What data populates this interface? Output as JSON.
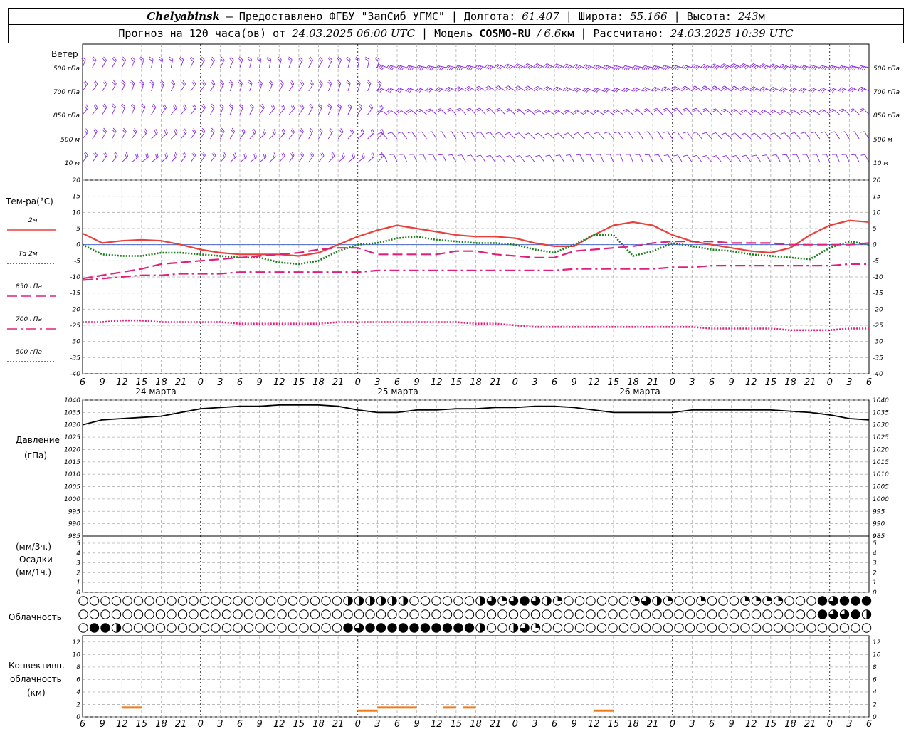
{
  "header": {
    "city": "Chelyabinsk",
    "dash": "—",
    "provider": "Предоставлено ФГБУ \"ЗапСиб УГМС\"",
    "lon_label": "Долгота:",
    "lon_value": "61.407",
    "lat_label": "Широта:",
    "lat_value": "55.166",
    "alt_label": "Высота:",
    "alt_value": "243",
    "alt_unit": "м",
    "forecast_prefix": "Прогноз на 120 часа(ов) от",
    "forecast_time": "24.03.2025 06:00 UTC",
    "model_label": "Модель",
    "model_name": "COSMO-RU",
    "model_res": "/ 6.6",
    "model_res_unit": "км",
    "calc_label": "Рассчитано:",
    "calc_time": "24.03.2025 10:39 UTC"
  },
  "wind_panel": {
    "title": "Ветер",
    "levels": [
      "500 гПа",
      "700 гПа",
      "850 гПа",
      "500 м",
      "10 м"
    ],
    "color": "#8a2be2"
  },
  "temp_panel": {
    "title": "Тем-ра(°C)",
    "yticks": [
      "20",
      "15",
      "10",
      "5",
      "0",
      "-5",
      "-10",
      "-15",
      "-20",
      "-25",
      "-30",
      "-35",
      "-40"
    ],
    "legend": [
      {
        "label": "2м",
        "color": "#e8413c",
        "style": "solid"
      },
      {
        "label": "Td 2м",
        "color": "#1a7f1a",
        "style": "dotted"
      },
      {
        "label": "850 гПа",
        "color": "#e0207e",
        "style": "dashed"
      },
      {
        "label": "700 гПа",
        "color": "#e0207e",
        "style": "dashdot"
      },
      {
        "label": "500 гПа",
        "color": "#e0207e",
        "style": "dotted"
      }
    ]
  },
  "pressure_panel": {
    "title": "Давление",
    "unit": "(гПа)",
    "yticks": [
      "1040",
      "1035",
      "1030",
      "1025",
      "1020",
      "1015",
      "1010",
      "1005",
      "1000",
      "995",
      "990",
      "985"
    ]
  },
  "precip_panel": {
    "unit3": "(мм/3ч.)",
    "title": "Осадки",
    "unit1": "(мм/1ч.)",
    "yticks": [
      "5",
      "4",
      "3",
      "2",
      "1",
      "0"
    ]
  },
  "cloud_panel": {
    "title": "Облачность"
  },
  "conv_panel": {
    "title1": "Конвективн.",
    "title2": "облачность",
    "unit": "(км)",
    "yticks": [
      "12",
      "10",
      "8",
      "6",
      "4",
      "2",
      "0"
    ],
    "color": "#f07c1a"
  },
  "x_axis": {
    "hour_labels": [
      "6",
      "9",
      "12",
      "15",
      "18",
      "21",
      "0",
      "3",
      "6",
      "9",
      "12",
      "15",
      "18",
      "21",
      "0",
      "3",
      "6",
      "9",
      "12",
      "15",
      "18",
      "21",
      "0",
      "3",
      "6",
      "9",
      "12"
    ],
    "day_labels": [
      "24 марта",
      "25 марта",
      "26 марта"
    ]
  },
  "chart_data": [
    {
      "type": "line",
      "title": "Тем-ра(°C)",
      "x_hours_from_start": [
        0,
        3,
        6,
        9,
        12,
        15,
        18,
        21,
        24,
        27,
        30,
        33,
        36,
        39,
        42,
        45,
        48,
        51,
        54,
        57,
        60,
        63,
        66,
        69,
        72,
        75,
        78,
        81,
        84,
        87,
        90,
        93,
        96,
        99,
        102,
        105,
        108,
        111,
        114,
        117,
        120
      ],
      "series": [
        {
          "name": "2м",
          "values": [
            3.5,
            0.5,
            1.2,
            1.5,
            1.2,
            0,
            -1.5,
            -2.5,
            -3,
            -3,
            -3,
            -3.5,
            -2.5,
            0,
            2.5,
            4.5,
            6,
            5,
            4,
            3,
            2.5,
            2.5,
            2,
            0.5,
            -0.5,
            -0.5,
            3,
            6,
            7,
            6,
            3,
            1,
            0,
            -1,
            -2,
            -2.5,
            -1,
            3,
            6,
            7.5,
            7
          ]
        },
        {
          "name": "Td 2м",
          "values": [
            0,
            -3,
            -3.5,
            -3.5,
            -2.5,
            -2.5,
            -3,
            -3.5,
            -4,
            -4,
            -5.5,
            -6,
            -5,
            -2,
            0,
            0.5,
            2,
            2.5,
            1.5,
            1,
            0.5,
            0.5,
            0,
            -1.5,
            -2.5,
            0,
            3,
            3,
            -3.5,
            -2,
            0.5,
            -0.5,
            -1.5,
            -2,
            -3,
            -3.5,
            -4,
            -4.5,
            -1,
            1,
            0
          ]
        },
        {
          "name": "850 гПа",
          "values": [
            -10.5,
            -9.5,
            -8.5,
            -7.5,
            -6,
            -5.5,
            -5,
            -4.5,
            -4,
            -3.5,
            -3,
            -2.5,
            -1.5,
            -1,
            -1,
            -3,
            -3,
            -3,
            -3,
            -2,
            -2,
            -3,
            -3.5,
            -4,
            -4,
            -2,
            -1.5,
            -1,
            -0.5,
            0.5,
            1,
            1,
            1,
            0.5,
            0.5,
            0.5,
            0,
            0,
            0,
            0,
            0.5
          ]
        },
        {
          "name": "700 гПа",
          "values": [
            -11,
            -10.5,
            -10,
            -9.5,
            -9.5,
            -9,
            -9,
            -9,
            -8.5,
            -8.5,
            -8.5,
            -8.5,
            -8.5,
            -8.5,
            -8.5,
            -8,
            -8,
            -8,
            -8,
            -8,
            -8,
            -8,
            -8,
            -8,
            -8,
            -7.5,
            -7.5,
            -7.5,
            -7.5,
            -7.5,
            -7,
            -7,
            -6.5,
            -6.5,
            -6.5,
            -6.5,
            -6.5,
            -6.5,
            -6.5,
            -6,
            -6
          ]
        },
        {
          "name": "500 гПа",
          "values": [
            -24,
            -24,
            -23.5,
            -23.5,
            -24,
            -24,
            -24,
            -24,
            -24.5,
            -24.5,
            -24.5,
            -24.5,
            -24.5,
            -24,
            -24,
            -24,
            -24,
            -24,
            -24,
            -24,
            -24.5,
            -24.5,
            -25,
            -25.5,
            -25.5,
            -25.5,
            -25.5,
            -25.5,
            -25.5,
            -25.5,
            -25.5,
            -25.5,
            -26,
            -26,
            -26,
            -26,
            -26.5,
            -26.5,
            -26.5,
            -26,
            -26
          ]
        }
      ],
      "ylim": [
        -40,
        20
      ]
    },
    {
      "type": "line",
      "title": "Давление",
      "ylabel": "(гПа)",
      "x_hours_from_start": [
        0,
        3,
        6,
        9,
        12,
        15,
        18,
        21,
        24,
        27,
        30,
        33,
        36,
        39,
        42,
        45,
        48,
        51,
        54,
        57,
        60,
        63,
        66,
        69,
        72,
        75,
        78,
        81,
        84,
        87,
        90,
        93,
        96,
        99,
        102,
        105,
        108,
        111,
        114,
        117,
        120
      ],
      "values": [
        1030,
        1032,
        1032.5,
        1033,
        1033.5,
        1035,
        1036.5,
        1037,
        1037.5,
        1037.5,
        1038,
        1038,
        1038,
        1037.5,
        1036,
        1035,
        1035,
        1036,
        1036,
        1036.5,
        1036.5,
        1037,
        1037,
        1037.5,
        1037.5,
        1037,
        1036,
        1035,
        1035,
        1035,
        1035,
        1036,
        1036,
        1036,
        1036,
        1036,
        1035.5,
        1035,
        1034,
        1032.5,
        1032
      ],
      "ylim": [
        985,
        1040
      ]
    },
    {
      "type": "bar",
      "title": "Осадки",
      "ylabel": "(мм/3ч.) (мм/1ч.)",
      "values": [],
      "ylim": [
        0,
        5
      ]
    },
    {
      "type": "bar",
      "title": "Конвективн. облачность",
      "ylabel": "(км)",
      "segments": [
        {
          "x0": 6,
          "x1": 9,
          "top_km": 1.5
        },
        {
          "x0": 42,
          "x1": 45,
          "top_km": 1
        },
        {
          "x0": 45,
          "x1": 51,
          "top_km": 1.5
        },
        {
          "x0": 55,
          "x1": 57,
          "top_km": 1.5
        },
        {
          "x0": 58,
          "x1": 60,
          "top_km": 1.5
        },
        {
          "x0": 78,
          "x1": 81,
          "top_km": 1
        }
      ],
      "ylim": [
        0,
        12
      ]
    }
  ]
}
